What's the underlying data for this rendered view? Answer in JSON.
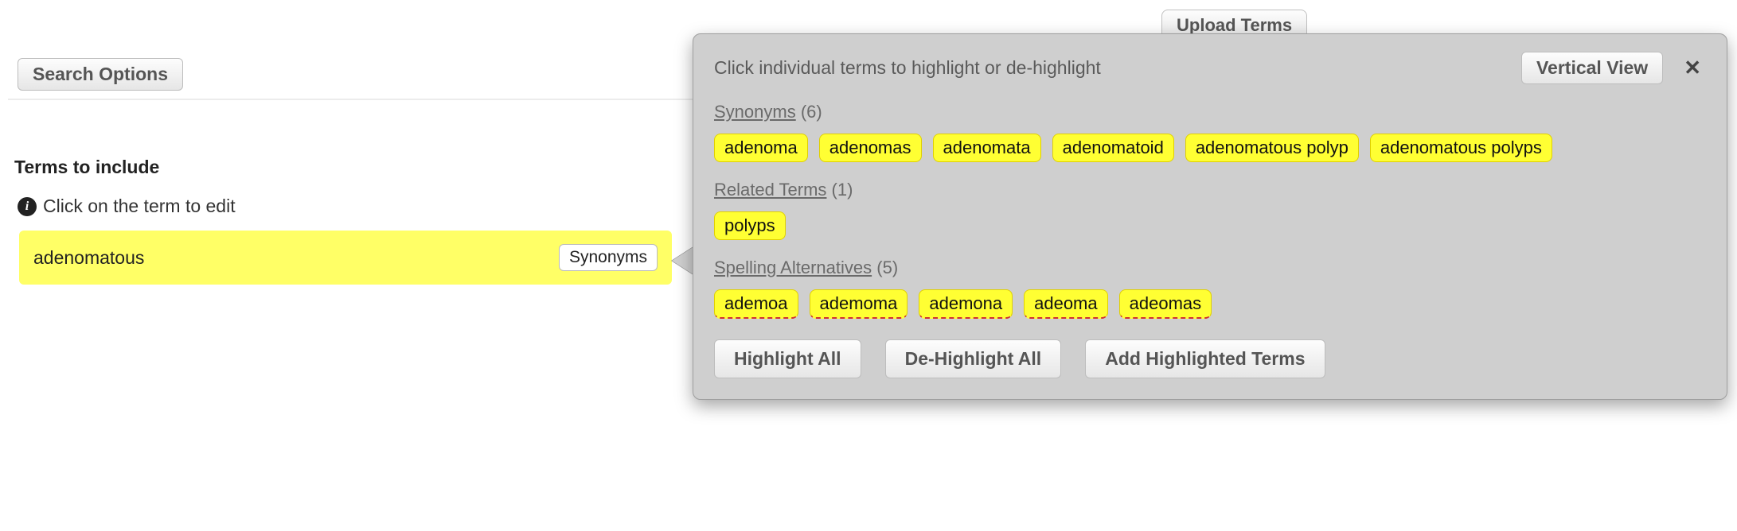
{
  "buttons": {
    "search_options": "Search Options",
    "upload_terms": "Upload Terms",
    "vertical_view": "Vertical View",
    "highlight_all": "Highlight All",
    "de_highlight_all": "De-Highlight All",
    "add_highlighted": "Add Highlighted Terms",
    "synonyms": "Synonyms"
  },
  "left": {
    "terms_heading": "Terms to include",
    "info_hint": "Click on the term to edit",
    "term_value": "adenomatous"
  },
  "panel": {
    "instruction": "Click individual terms to highlight or de-highlight",
    "sections": {
      "synonyms": {
        "label": "Synonyms",
        "count": 6,
        "items": [
          "adenoma",
          "adenomas",
          "adenomata",
          "adenomatoid",
          "adenomatous polyp",
          "adenomatous polyps"
        ]
      },
      "related": {
        "label": "Related Terms",
        "count": 1,
        "items": [
          "polyps"
        ]
      },
      "spelling": {
        "label": "Spelling Alternatives",
        "count": 5,
        "items": [
          "ademoa",
          "ademoma",
          "ademona",
          "adeoma",
          "adeomas"
        ]
      }
    }
  }
}
